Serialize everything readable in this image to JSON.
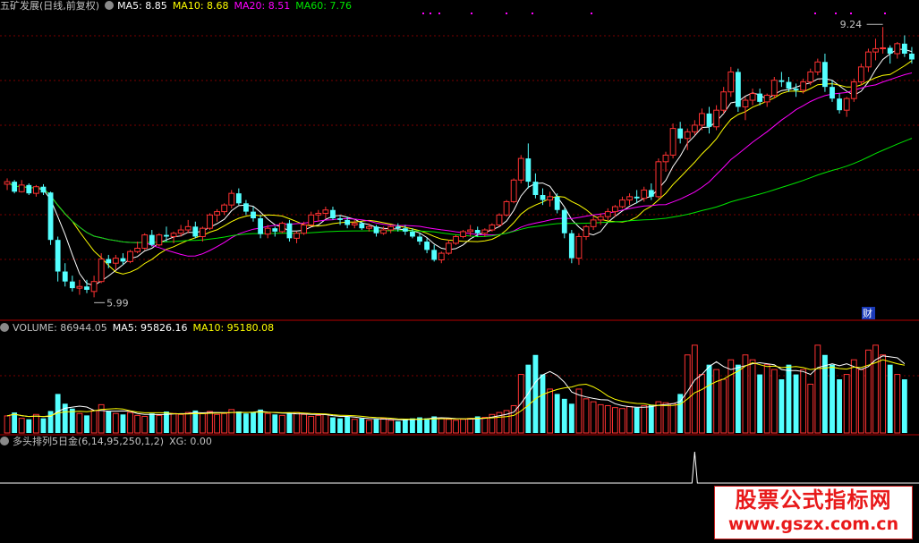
{
  "colors": {
    "up": "#ff3232",
    "down": "#54ffff",
    "ma5": "#ffffff",
    "ma10": "#ffff00",
    "ma20": "#ff00ff",
    "ma60": "#00e600",
    "grid": "#7a0000",
    "separator": "#b40000",
    "text": "#c0c0c0"
  },
  "price_header": {
    "title": "五矿发展(日线,前复权)",
    "ma5": "MA5: 8.85",
    "ma10": "MA10: 8.68",
    "ma20": "MA20: 8.51",
    "ma60": "MA60: 7.76"
  },
  "volume_header": {
    "volume": "VOLUME: 86944.05",
    "ma5": "MA5: 95826.16",
    "ma10": "MA10: 95180.08"
  },
  "indicator_header": {
    "name": "多头排列5日金(6,14,95,250,1,2)",
    "xg": "XG: 0.00"
  },
  "annotations": {
    "high": "9.24",
    "low": "5.99",
    "marker": "财"
  },
  "watermark": {
    "line1": "股票公式指标网",
    "line2": "www.gszx.com.cn"
  },
  "chart_data": [
    {
      "type": "candlestick",
      "price_range": [
        5.8,
        9.35
      ],
      "highest": 9.24,
      "lowest": 5.99,
      "ohlc": [
        [
          7.35,
          7.42,
          7.28,
          7.38
        ],
        [
          7.38,
          7.4,
          7.24,
          7.26
        ],
        [
          7.26,
          7.4,
          7.25,
          7.34
        ],
        [
          7.34,
          7.36,
          7.22,
          7.24
        ],
        [
          7.24,
          7.34,
          7.2,
          7.32
        ],
        [
          7.32,
          7.35,
          7.22,
          7.25
        ],
        [
          7.25,
          7.26,
          6.62,
          6.68
        ],
        [
          6.68,
          6.72,
          6.18,
          6.3
        ],
        [
          6.3,
          6.4,
          6.12,
          6.18
        ],
        [
          6.18,
          6.25,
          6.06,
          6.1
        ],
        [
          6.1,
          6.2,
          6.02,
          6.12
        ],
        [
          6.12,
          6.2,
          6.04,
          6.08
        ],
        [
          6.06,
          6.25,
          5.99,
          6.18
        ],
        [
          6.18,
          6.52,
          6.16,
          6.45
        ],
        [
          6.45,
          6.5,
          6.34,
          6.4
        ],
        [
          6.4,
          6.5,
          6.32,
          6.46
        ],
        [
          6.46,
          6.52,
          6.38,
          6.42
        ],
        [
          6.42,
          6.56,
          6.4,
          6.54
        ],
        [
          6.54,
          6.66,
          6.52,
          6.58
        ],
        [
          6.58,
          6.76,
          6.56,
          6.74
        ],
        [
          6.74,
          6.8,
          6.6,
          6.62
        ],
        [
          6.62,
          6.76,
          6.6,
          6.74
        ],
        [
          6.74,
          6.84,
          6.66,
          6.72
        ],
        [
          6.72,
          6.78,
          6.64,
          6.76
        ],
        [
          6.76,
          6.86,
          6.72,
          6.8
        ],
        [
          6.8,
          6.92,
          6.76,
          6.84
        ],
        [
          6.84,
          6.9,
          6.7,
          6.72
        ],
        [
          6.72,
          6.84,
          6.66,
          6.82
        ],
        [
          6.82,
          7.0,
          6.8,
          6.98
        ],
        [
          6.98,
          7.05,
          6.9,
          7.02
        ],
        [
          7.02,
          7.12,
          6.98,
          7.1
        ],
        [
          7.1,
          7.28,
          7.06,
          7.24
        ],
        [
          7.24,
          7.3,
          7.1,
          7.12
        ],
        [
          7.12,
          7.16,
          6.98,
          7.02
        ],
        [
          7.02,
          7.08,
          6.9,
          6.94
        ],
        [
          6.94,
          6.98,
          6.7,
          6.75
        ],
        [
          6.75,
          6.86,
          6.7,
          6.82
        ],
        [
          6.82,
          6.84,
          6.72,
          6.78
        ],
        [
          6.78,
          6.9,
          6.76,
          6.88
        ],
        [
          6.88,
          6.92,
          6.66,
          6.7
        ],
        [
          6.7,
          6.78,
          6.64,
          6.76
        ],
        [
          6.76,
          6.9,
          6.74,
          6.86
        ],
        [
          6.86,
          7.02,
          6.84,
          6.98
        ],
        [
          6.98,
          7.04,
          6.9,
          7.0
        ],
        [
          7.0,
          7.08,
          6.94,
          7.04
        ],
        [
          7.04,
          7.08,
          6.92,
          6.94
        ],
        [
          6.94,
          6.98,
          6.86,
          6.92
        ],
        [
          6.92,
          6.96,
          6.82,
          6.86
        ],
        [
          6.86,
          6.92,
          6.82,
          6.88
        ],
        [
          6.88,
          6.9,
          6.8,
          6.82
        ],
        [
          6.82,
          6.88,
          6.78,
          6.84
        ],
        [
          6.84,
          6.86,
          6.72,
          6.76
        ],
        [
          6.76,
          6.84,
          6.74,
          6.8
        ],
        [
          6.8,
          6.86,
          6.76,
          6.84
        ],
        [
          6.84,
          6.88,
          6.78,
          6.82
        ],
        [
          6.82,
          6.86,
          6.74,
          6.78
        ],
        [
          6.78,
          6.82,
          6.7,
          6.72
        ],
        [
          6.72,
          6.76,
          6.62,
          6.66
        ],
        [
          6.66,
          6.7,
          6.52,
          6.56
        ],
        [
          6.56,
          6.62,
          6.42,
          6.44
        ],
        [
          6.44,
          6.54,
          6.4,
          6.52
        ],
        [
          6.52,
          6.68,
          6.5,
          6.64
        ],
        [
          6.64,
          6.74,
          6.62,
          6.72
        ],
        [
          6.72,
          6.8,
          6.7,
          6.78
        ],
        [
          6.78,
          6.86,
          6.72,
          6.8
        ],
        [
          6.8,
          6.84,
          6.72,
          6.76
        ],
        [
          6.76,
          6.82,
          6.72,
          6.8
        ],
        [
          6.8,
          6.88,
          6.78,
          6.86
        ],
        [
          6.86,
          7.0,
          6.84,
          6.98
        ],
        [
          6.98,
          7.16,
          6.96,
          7.14
        ],
        [
          7.14,
          7.42,
          7.12,
          7.4
        ],
        [
          7.4,
          7.7,
          7.36,
          7.66
        ],
        [
          7.66,
          7.84,
          7.3,
          7.38
        ],
        [
          7.38,
          7.48,
          7.18,
          7.22
        ],
        [
          7.22,
          7.3,
          7.1,
          7.16
        ],
        [
          7.16,
          7.26,
          7.08,
          7.2
        ],
        [
          7.2,
          7.24,
          7.0,
          7.04
        ],
        [
          7.04,
          7.06,
          6.7,
          6.76
        ],
        [
          6.76,
          6.8,
          6.4,
          6.46
        ],
        [
          6.46,
          6.76,
          6.38,
          6.72
        ],
        [
          6.72,
          6.86,
          6.68,
          6.84
        ],
        [
          6.84,
          6.96,
          6.8,
          6.92
        ],
        [
          6.92,
          7.0,
          6.86,
          6.96
        ],
        [
          6.96,
          7.06,
          6.92,
          7.02
        ],
        [
          7.02,
          7.1,
          6.96,
          7.08
        ],
        [
          7.08,
          7.2,
          7.06,
          7.16
        ],
        [
          7.16,
          7.24,
          7.1,
          7.2
        ],
        [
          7.2,
          7.28,
          7.12,
          7.18
        ],
        [
          7.18,
          7.32,
          7.14,
          7.28
        ],
        [
          7.28,
          7.36,
          7.16,
          7.2
        ],
        [
          7.2,
          7.66,
          7.18,
          7.62
        ],
        [
          7.62,
          7.74,
          7.5,
          7.7
        ],
        [
          7.7,
          8.08,
          7.66,
          8.02
        ],
        [
          8.02,
          8.1,
          7.84,
          7.9
        ],
        [
          7.9,
          8.02,
          7.76,
          7.98
        ],
        [
          7.98,
          8.12,
          7.94,
          8.06
        ],
        [
          8.06,
          8.26,
          8.0,
          8.2
        ],
        [
          8.2,
          8.28,
          7.96,
          8.04
        ],
        [
          8.04,
          8.3,
          8.0,
          8.24
        ],
        [
          8.24,
          8.52,
          8.2,
          8.46
        ],
        [
          8.46,
          8.76,
          8.4,
          8.7
        ],
        [
          8.7,
          8.74,
          8.22,
          8.28
        ],
        [
          8.28,
          8.4,
          8.12,
          8.36
        ],
        [
          8.36,
          8.5,
          8.3,
          8.44
        ],
        [
          8.44,
          8.5,
          8.3,
          8.34
        ],
        [
          8.34,
          8.44,
          8.28,
          8.42
        ],
        [
          8.42,
          8.64,
          8.38,
          8.6
        ],
        [
          8.6,
          8.7,
          8.52,
          8.58
        ],
        [
          8.58,
          8.64,
          8.46,
          8.5
        ],
        [
          8.5,
          8.56,
          8.4,
          8.48
        ],
        [
          8.48,
          8.62,
          8.44,
          8.58
        ],
        [
          8.58,
          8.74,
          8.54,
          8.7
        ],
        [
          8.7,
          8.86,
          8.66,
          8.82
        ],
        [
          8.82,
          8.92,
          8.46,
          8.52
        ],
        [
          8.52,
          8.6,
          8.34,
          8.38
        ],
        [
          8.38,
          8.44,
          8.2,
          8.24
        ],
        [
          8.24,
          8.4,
          8.16,
          8.38
        ],
        [
          8.38,
          8.62,
          8.34,
          8.58
        ],
        [
          8.58,
          8.8,
          8.54,
          8.76
        ],
        [
          8.76,
          8.98,
          8.7,
          8.94
        ],
        [
          8.94,
          9.1,
          8.84,
          8.98
        ],
        [
          8.98,
          9.24,
          8.92,
          8.99
        ],
        [
          8.99,
          9.02,
          8.8,
          8.92
        ],
        [
          8.92,
          9.06,
          8.86,
          9.04
        ],
        [
          9.04,
          9.14,
          8.88,
          8.92
        ],
        [
          8.92,
          9.0,
          8.8,
          8.85
        ]
      ]
    },
    {
      "type": "bar",
      "series": "volume",
      "values": [
        35,
        42,
        30,
        28,
        38,
        30,
        45,
        80,
        60,
        50,
        40,
        36,
        46,
        58,
        44,
        40,
        38,
        42,
        36,
        34,
        40,
        36,
        44,
        40,
        38,
        42,
        46,
        40,
        44,
        38,
        40,
        48,
        44,
        40,
        42,
        48,
        40,
        38,
        36,
        40,
        42,
        38,
        34,
        36,
        38,
        32,
        30,
        34,
        28,
        30,
        26,
        28,
        30,
        26,
        24,
        28,
        30,
        32,
        30,
        34,
        30,
        28,
        26,
        28,
        30,
        34,
        32,
        38,
        42,
        46,
        56,
        120,
        140,
        160,
        120,
        90,
        80,
        70,
        60,
        90,
        70,
        64,
        58,
        56,
        52,
        50,
        54,
        52,
        56,
        58,
        64,
        62,
        60,
        80,
        160,
        180,
        120,
        140,
        130,
        110,
        150,
        140,
        160,
        150,
        120,
        140,
        130,
        110,
        140,
        120,
        130,
        100,
        180,
        160,
        140,
        110,
        120,
        150,
        130,
        170,
        180,
        160,
        140,
        120,
        110
      ]
    },
    {
      "type": "line",
      "series": "XG",
      "value": 0.0
    }
  ]
}
